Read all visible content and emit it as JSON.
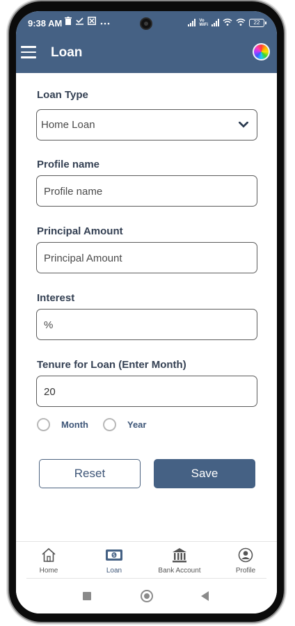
{
  "status_bar": {
    "time": "9:38 AM",
    "left_icons": [
      "delete-icon",
      "download-done-icon",
      "app-icon",
      "more-icon"
    ],
    "vo_wifi_label": "Vo\nWiFi",
    "battery_level": "22"
  },
  "app_bar": {
    "title": "Loan"
  },
  "form": {
    "loan_type_label": "Loan Type",
    "loan_type_value": "Home Loan",
    "profile_name_label": "Profile name",
    "profile_name_placeholder": "Profile name",
    "principal_label": "Principal Amount",
    "principal_placeholder": "Principal Amount",
    "interest_label": "Interest",
    "interest_placeholder": "%",
    "tenure_label": "Tenure for Loan (Enter Month)",
    "tenure_value": "20",
    "radio_month_label": "Month",
    "radio_year_label": "Year",
    "reset_label": "Reset",
    "save_label": "Save"
  },
  "bottom_nav": {
    "items": [
      {
        "label": "Home",
        "icon": "home-icon",
        "active": false
      },
      {
        "label": "Loan",
        "icon": "banknote-icon",
        "active": true
      },
      {
        "label": "Bank Account",
        "icon": "bank-icon",
        "active": false
      },
      {
        "label": "Profile",
        "icon": "profile-icon",
        "active": false
      }
    ]
  },
  "colors": {
    "primary": "#456184",
    "label_text": "#344053",
    "accent_text": "#3d5577"
  }
}
